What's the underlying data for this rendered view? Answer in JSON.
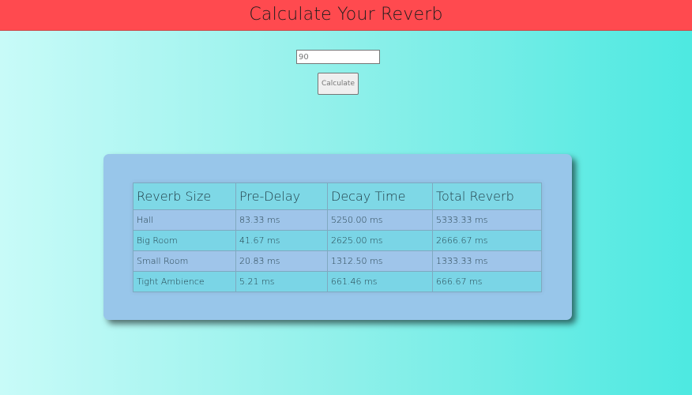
{
  "header": {
    "title": "Calculate Your Reverb"
  },
  "form": {
    "input_value": "90",
    "calculate_label": "Calculate"
  },
  "table": {
    "columns": [
      "Reverb Size",
      "Pre-Delay",
      "Decay Time",
      "Total Reverb"
    ],
    "rows": [
      [
        "Hall",
        "83.33 ms",
        "5250.00 ms",
        "5333.33 ms"
      ],
      [
        "Big Room",
        "41.67 ms",
        "2625.00 ms",
        "2666.67 ms"
      ],
      [
        "Small Room",
        "20.83 ms",
        "1312.50 ms",
        "1333.33 ms"
      ],
      [
        "Tight Ambience",
        "5.21 ms",
        "661.46 ms",
        "666.67 ms"
      ]
    ]
  },
  "colors": {
    "header_bg": "#ff4a4f",
    "card_bg": "#98c6ea",
    "row_alt_bg": "#7ad5e6"
  }
}
